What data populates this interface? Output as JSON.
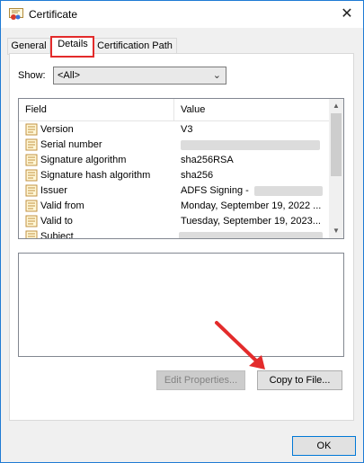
{
  "window": {
    "title": "Certificate",
    "close_glyph": "✕"
  },
  "tabs": [
    {
      "label": "General"
    },
    {
      "label": "Details"
    },
    {
      "label": "Certification Path"
    }
  ],
  "show": {
    "label": "Show:",
    "value": "<All>",
    "arrow_glyph": "⌄"
  },
  "list": {
    "columns": {
      "field": "Field",
      "value": "Value"
    },
    "rows": [
      {
        "field": "Version",
        "value": "V3"
      },
      {
        "field": "Serial number",
        "value": ""
      },
      {
        "field": "Signature algorithm",
        "value": "sha256RSA"
      },
      {
        "field": "Signature hash algorithm",
        "value": "sha256"
      },
      {
        "field": "Issuer",
        "value": "ADFS Signing -"
      },
      {
        "field": "Valid from",
        "value": "Monday, September 19, 2022 ..."
      },
      {
        "field": "Valid to",
        "value": "Tuesday, September 19, 2023..."
      },
      {
        "field": "Subject",
        "value": ""
      }
    ]
  },
  "buttons": {
    "edit_properties": "Edit Properties...",
    "copy_to_file": "Copy to File...",
    "ok": "OK"
  },
  "colors": {
    "highlight": "#e32b2b",
    "focus": "#0078d7"
  }
}
